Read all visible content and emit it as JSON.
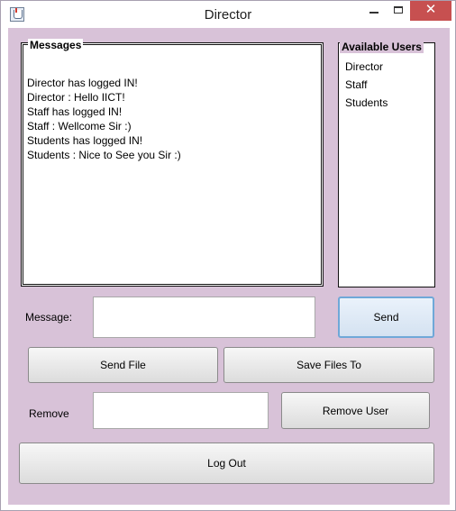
{
  "window": {
    "title": "Director"
  },
  "messages": {
    "legend": "Messages",
    "lines": [
      "Director has logged IN!",
      "Director : Hello IICT!",
      "Staff has logged IN!",
      "Staff : Wellcome Sir :)",
      "Students has logged IN!",
      "Students : Nice to See you Sir :)"
    ]
  },
  "users": {
    "legend": "Available Users",
    "items": [
      "Director",
      "Staff",
      "Students"
    ]
  },
  "compose": {
    "message_label": "Message:",
    "message_value": "",
    "send_label": "Send"
  },
  "files": {
    "send_file_label": "Send File",
    "save_files_label": "Save Files To"
  },
  "remove": {
    "label": "Remove",
    "value": "",
    "button_label": "Remove User"
  },
  "logout": {
    "label": "Log Out"
  },
  "colors": {
    "client_background": "#d8c2d8",
    "close_button": "#c75050",
    "focus_border": "#6fa8d8"
  }
}
